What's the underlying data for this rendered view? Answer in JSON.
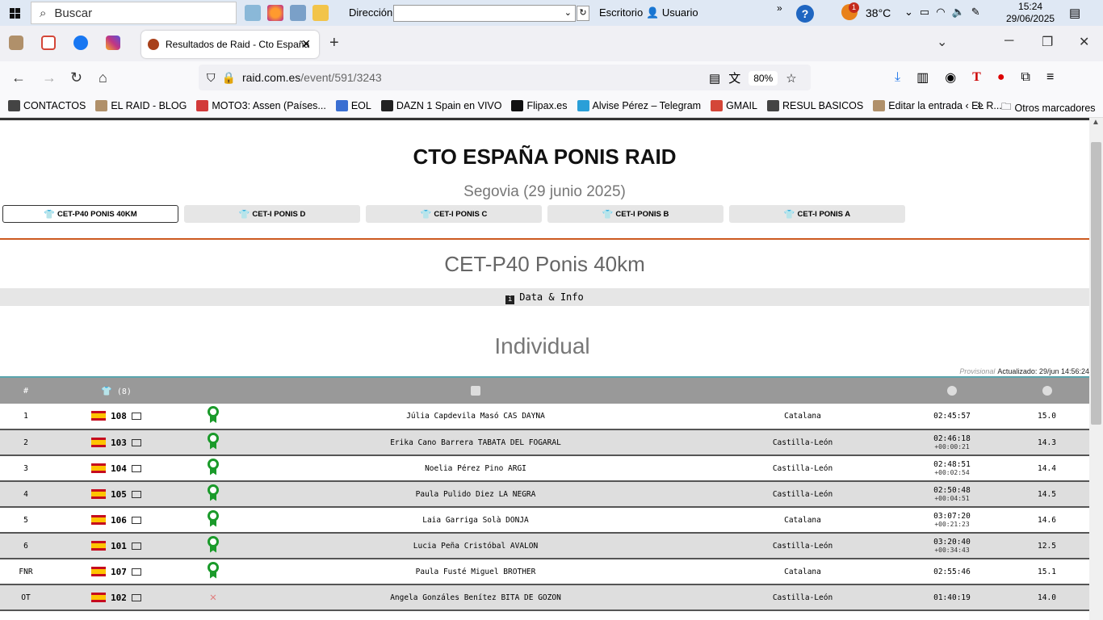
{
  "taskbar": {
    "search_placeholder": "Buscar",
    "address_label": "Dirección",
    "desktop_label": "Escritorio",
    "user_label": "Usuario",
    "temperature": "38°C",
    "weather_badge": "1",
    "time": "15:24",
    "date": "29/06/2025"
  },
  "browser": {
    "tab_title": "Resultados de Raid - Cto España",
    "url_host": "raid.com.es",
    "url_path": "/event/591/3243",
    "zoom": "80%",
    "bookmarks": [
      {
        "label": "CONTACTOS",
        "icon": "folder-icon",
        "color": "#444444"
      },
      {
        "label": "EL RAID - BLOG",
        "icon": "blog-icon",
        "color": "#b0906a"
      },
      {
        "label": "MOTO3: Assen (Países...",
        "icon": "tv-icon",
        "color": "#d23a3a"
      },
      {
        "label": "EOL",
        "icon": "eol-icon",
        "color": "#3a6fd2"
      },
      {
        "label": "DAZN 1 Spain en VIVO",
        "icon": "ball-icon",
        "color": "#222222"
      },
      {
        "label": "Flipax.es",
        "icon": "fx-icon",
        "color": "#111111"
      },
      {
        "label": "Alvise Pérez – Telegram",
        "icon": "telegram-icon",
        "color": "#2a9fd8"
      },
      {
        "label": "GMAIL",
        "icon": "gmail-icon",
        "color": "#d44638"
      },
      {
        "label": "RESUL BASICOS",
        "icon": "folder-icon",
        "color": "#444444"
      },
      {
        "label": "Editar la entrada ‹ EL R...",
        "icon": "blog-icon",
        "color": "#b0906a"
      }
    ],
    "other_bookmarks": "Otros marcadores"
  },
  "event": {
    "title": "CTO ESPAÑA PONIS RAID",
    "subtitle": "Segovia (29 junio 2025)",
    "categories": [
      "CET-P40 PONIS 40KM",
      "CET-I PONIS D",
      "CET-I PONIS C",
      "CET-I PONIS B",
      "CET-I PONIS A"
    ],
    "category_title": "CET-P40 Ponis 40km",
    "info_label": "Data & Info",
    "section_title": "Individual",
    "provisional": "Provisional",
    "updated": "Actualizado: 29/jun 14:56:24",
    "count_label": "(8)",
    "pos_header": "#"
  },
  "results": [
    {
      "pos": "1",
      "bib": "108",
      "status": "ok",
      "name": "Júlia Capdevila Masó CAS DAYNA",
      "team": "Catalana",
      "time": "02:45:57",
      "gap": "",
      "speed": "15.0"
    },
    {
      "pos": "2",
      "bib": "103",
      "status": "ok",
      "name": "Erika Cano Barrera TABATA DEL FOGARAL",
      "team": "Castilla-León",
      "time": "02:46:18",
      "gap": "+00:00:21",
      "speed": "14.3"
    },
    {
      "pos": "3",
      "bib": "104",
      "status": "ok",
      "name": "Noelia Pérez Pino ARGI",
      "team": "Castilla-León",
      "time": "02:48:51",
      "gap": "+00:02:54",
      "speed": "14.4"
    },
    {
      "pos": "4",
      "bib": "105",
      "status": "ok",
      "name": "Paula Pulido Diez LA NEGRA",
      "team": "Castilla-León",
      "time": "02:50:48",
      "gap": "+00:04:51",
      "speed": "14.5"
    },
    {
      "pos": "5",
      "bib": "106",
      "status": "ok",
      "name": "Laia Garriga Solà DONJA",
      "team": "Catalana",
      "time": "03:07:20",
      "gap": "+00:21:23",
      "speed": "14.6"
    },
    {
      "pos": "6",
      "bib": "101",
      "status": "ok",
      "name": "Lucia Peña Cristóbal AVALON",
      "team": "Castilla-León",
      "time": "03:20:40",
      "gap": "+00:34:43",
      "speed": "12.5"
    },
    {
      "pos": "FNR",
      "bib": "107",
      "status": "ok",
      "name": "Paula Fusté Miguel BROTHER",
      "team": "Catalana",
      "time": "02:55:46",
      "gap": "",
      "speed": "15.1"
    },
    {
      "pos": "OT",
      "bib": "102",
      "status": "out",
      "name": "Angela Gonzáles Benítez BITA DE GOZON",
      "team": "Castilla-León",
      "time": "01:40:19",
      "gap": "",
      "speed": "14.0"
    }
  ]
}
